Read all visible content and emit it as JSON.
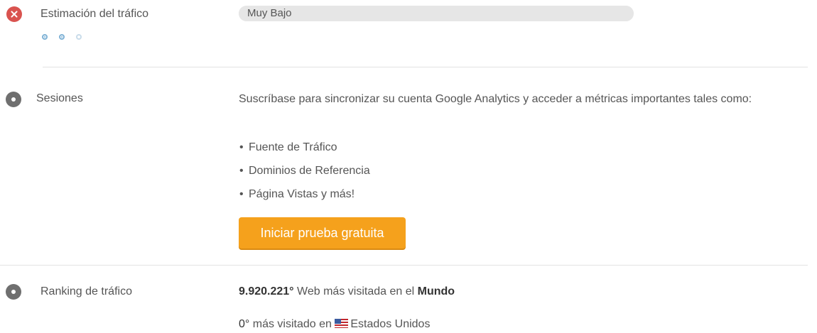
{
  "traffic_estimate": {
    "label": "Estimación del tráfico",
    "value": "Muy Bajo",
    "level_dots_filled": 2,
    "level_dots_total": 3
  },
  "sessions": {
    "label": "Sesiones",
    "description": "Suscríbase para sincronizar su cuenta Google Analytics y acceder a métricas importantes tales como:",
    "items": [
      "Fuente de Tráfico",
      "Dominios de Referencia",
      "Página Vistas y más!"
    ],
    "cta_label": "Iniciar prueba gratuita"
  },
  "ranking": {
    "label": "Ranking de tráfico",
    "world_rank": "9.920.221°",
    "world_text": "Web más visitada en el",
    "world_region": "Mundo",
    "country_rank": "0°",
    "country_text": "más visitado en",
    "country_name": "Estados Unidos"
  },
  "colors": {
    "accent": "#f5a11c",
    "error": "#d9534f"
  }
}
